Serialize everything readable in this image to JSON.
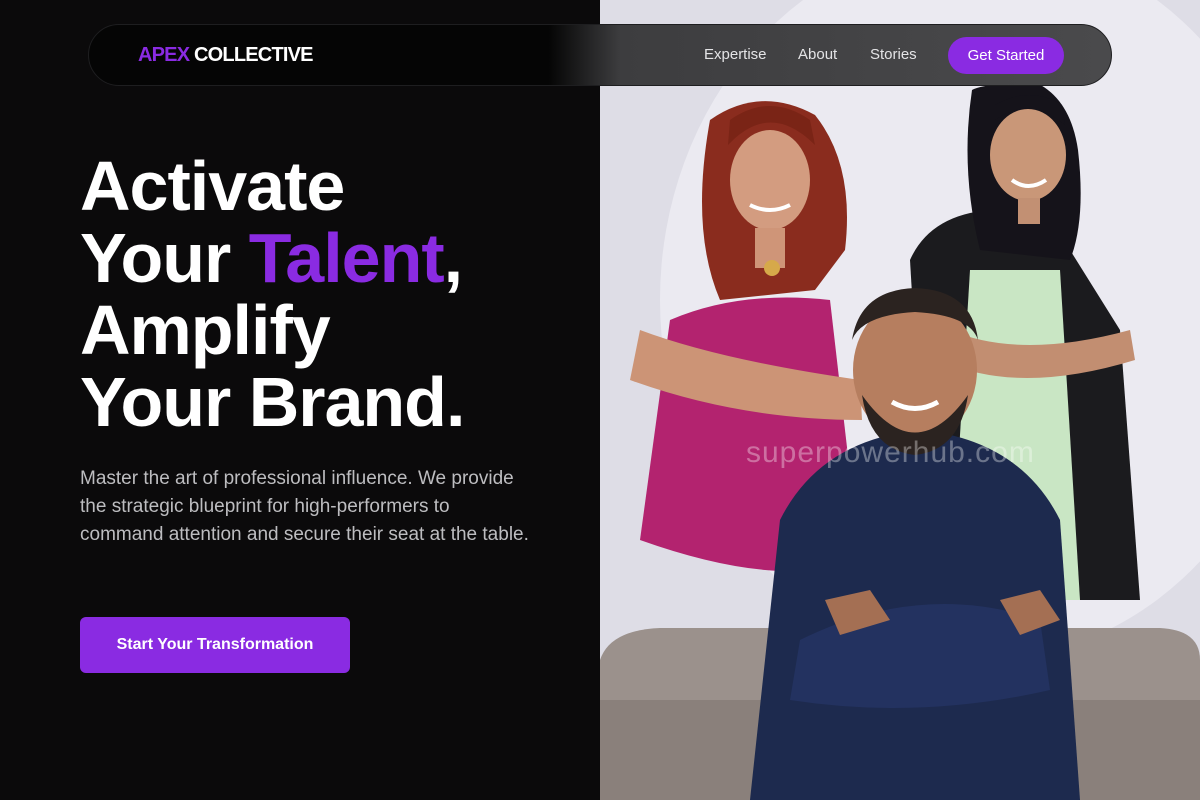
{
  "brand": {
    "accent": "APEX",
    "rest": "COLLECTIVE",
    "accent_color": "#8a2be2"
  },
  "nav": {
    "links": [
      "Expertise",
      "About",
      "Stories"
    ],
    "cta": "Get Started"
  },
  "hero": {
    "line1": "Activate",
    "line2_a": "Your ",
    "line2_highlight": "Talent",
    "line2_b": ",",
    "line3": "Amplify",
    "line4": "Your Brand.",
    "subtext": "Master the art of professional influence. We provide the strategic blueprint for high-performers to command attention and secure their seat at the table.",
    "cta": "Start Your Transformation"
  },
  "photo": {
    "watermark": "superpowerhub.com"
  },
  "colors": {
    "background": "#0b0a0b",
    "accent": "#8a2be2",
    "text": "#ffffff",
    "muted": "#bdbdc0"
  }
}
